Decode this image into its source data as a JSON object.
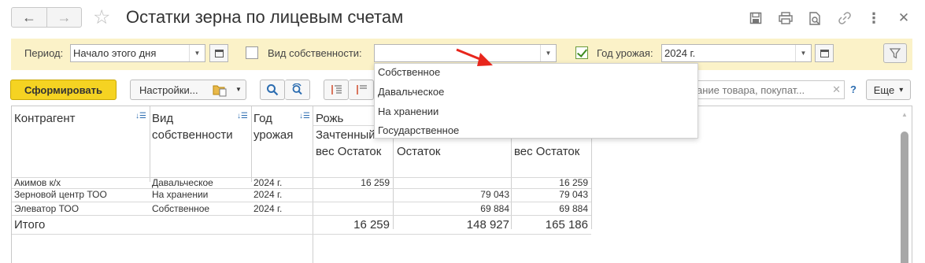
{
  "window": {
    "title": "Остатки зерна по лицевым счетам",
    "nav_back_icon": "arrow-left-icon",
    "nav_forward_icon": "arrow-right-icon",
    "favorite_icon": "star-icon",
    "actions": [
      "save-icon",
      "print-icon",
      "preview-icon",
      "link-icon",
      "more-vertical-icon",
      "close-icon"
    ]
  },
  "filters": {
    "period_label": "Период:",
    "period_value": "Начало этого дня",
    "ownership_label": "Вид собственности:",
    "ownership_value": "",
    "ownership_checked": false,
    "harvest_label": "Год урожая:",
    "harvest_value": "2024 г.",
    "harvest_checked": true
  },
  "toolbar": {
    "generate_label": "Сформировать",
    "settings_label": "Настройки...",
    "search_placeholder": "название товара, покупат...",
    "help_label": "?",
    "more_label": "Еще",
    "more_arrow": "▾"
  },
  "dropdown": {
    "options": [
      "Собственное",
      "Давальческое",
      "На хранении",
      "Государственное"
    ]
  },
  "report": {
    "headers": {
      "contractor": "Контрагент",
      "ownership": "Вид собственности",
      "year": "Год урожая",
      "crop": "Рожь",
      "col_credited": "Зачтенный вес Остаток",
      "col_physical": "Зачтенный вес Остаток",
      "col_total": "Зачтенный вес Остаток"
    },
    "rows": [
      {
        "contractor": "Акимов к/х",
        "ownership": "Давальческое",
        "year": "2024 г.",
        "v1": "16 259",
        "v2": "",
        "v3": "16 259"
      },
      {
        "contractor": "Зерновой центр ТОО",
        "ownership": "На хранении",
        "year": "2024 г.",
        "v1": "",
        "v2": "79 043",
        "v3": "79 043"
      },
      {
        "contractor": "Элеватор ТОО",
        "ownership": "Собственное",
        "year": "2024 г.",
        "v1": "",
        "v2": "69 884",
        "v3": "69 884"
      }
    ],
    "total": {
      "label": "Итого",
      "v1": "16 259",
      "v2": "148 927",
      "v3": "165 186"
    }
  },
  "colors": {
    "filter_bg": "#fbf2c8",
    "primary_button": "#f5d322",
    "annotation_arrow": "#e8261c"
  }
}
